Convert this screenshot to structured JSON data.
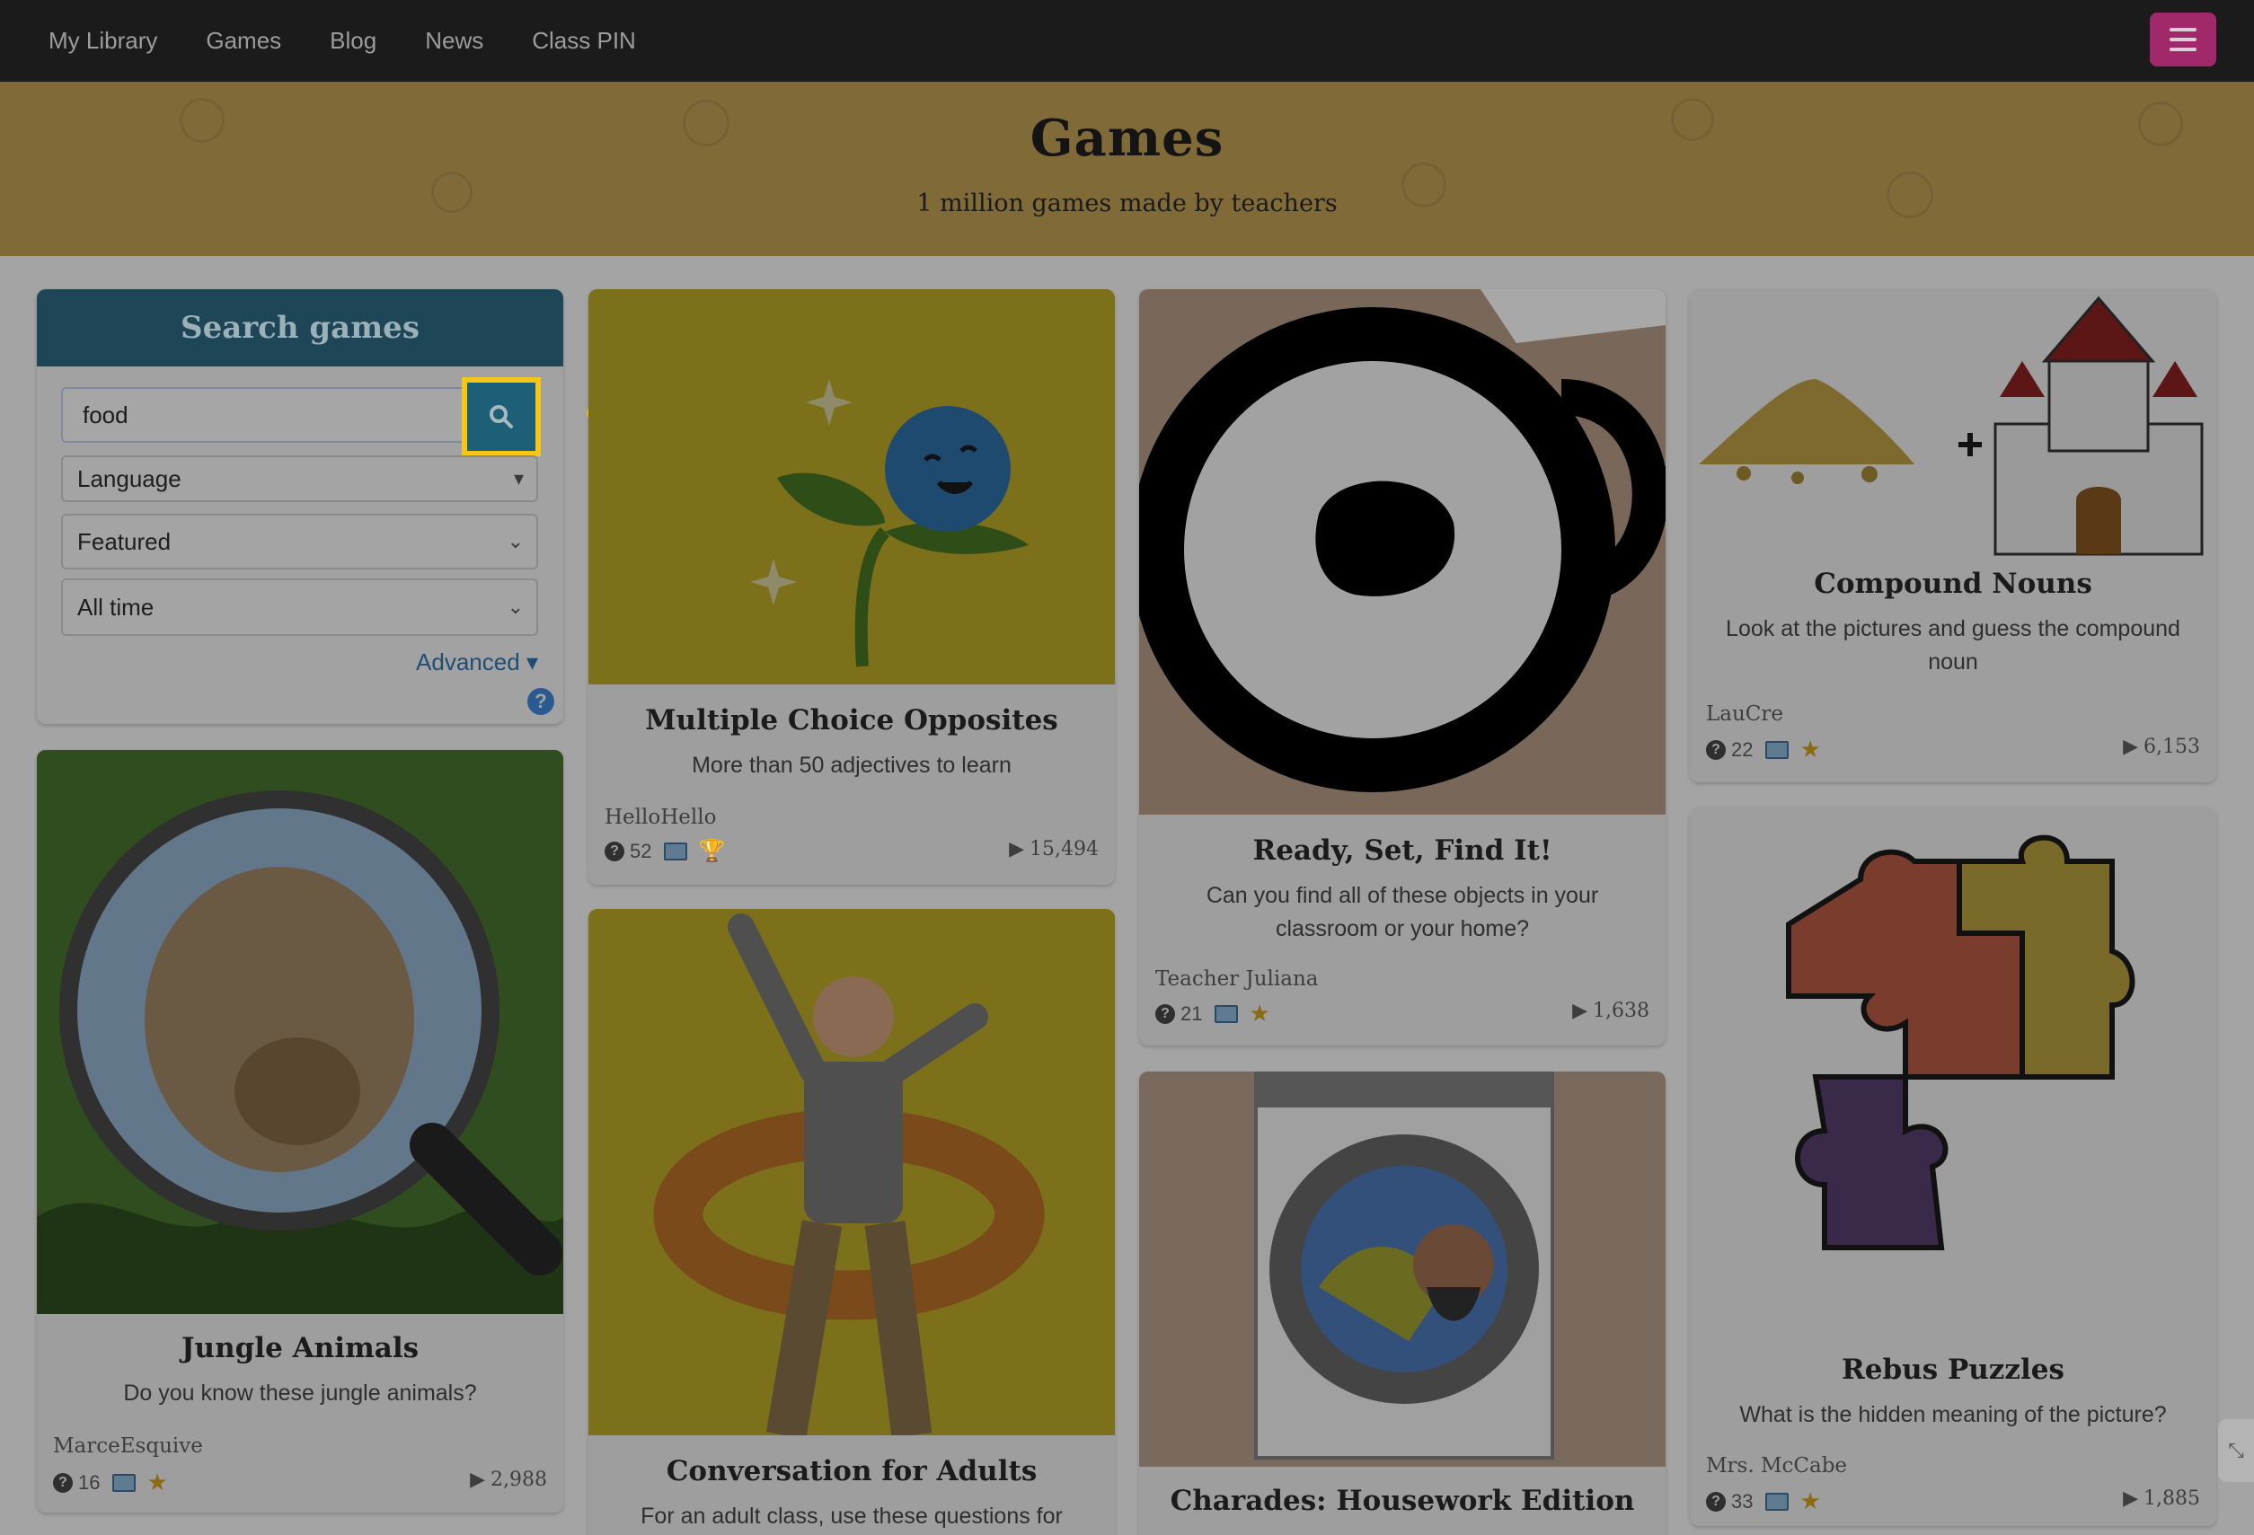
{
  "nav": {
    "links": [
      "My Library",
      "Games",
      "Blog",
      "News",
      "Class PIN"
    ],
    "menu_icon": "hamburger-icon"
  },
  "banner": {
    "title": "Games",
    "subtitle": "1 million games made by teachers"
  },
  "search": {
    "heading": "Search games",
    "query": "food",
    "language": "Language",
    "sort": "Featured",
    "period": "All time",
    "advanced": "Advanced",
    "search_icon": "magnifier-icon",
    "help_icon": "question-icon"
  },
  "cards": {
    "opposites": {
      "title": "Multiple Choice Opposites",
      "desc": "More than 50 adjectives to learn",
      "author": "HelloHello",
      "questions": "52",
      "plays": "15,494"
    },
    "find_it": {
      "title": "Ready, Set, Find It!",
      "desc": "Can you find all of these objects in your classroom or your home?",
      "author": "Teacher Juliana",
      "questions": "21",
      "plays": "1,638"
    },
    "compound": {
      "title": "Compound Nouns",
      "desc": "Look at the pictures and guess the compound noun",
      "author": "LauCre",
      "questions": "22",
      "plays": "6,153"
    },
    "jungle": {
      "title": "Jungle Animals",
      "desc": "Do you know these jungle animals?",
      "author": "MarceEsquive",
      "questions": "16",
      "plays": "2,988"
    },
    "conversation": {
      "title": "Conversation for Adults",
      "desc": "For an adult class, use these questions for"
    },
    "charades": {
      "title": "Charades: Housework Edition"
    },
    "rebus": {
      "title": "Rebus Puzzles",
      "desc": "What is the hidden meaning of the picture?",
      "author": "Mrs. McCabe",
      "questions": "33",
      "plays": "1,885"
    }
  },
  "colors": {
    "highlight": "#f5c518",
    "menu_button": "#a2286c",
    "search_header": "#1e4657"
  }
}
